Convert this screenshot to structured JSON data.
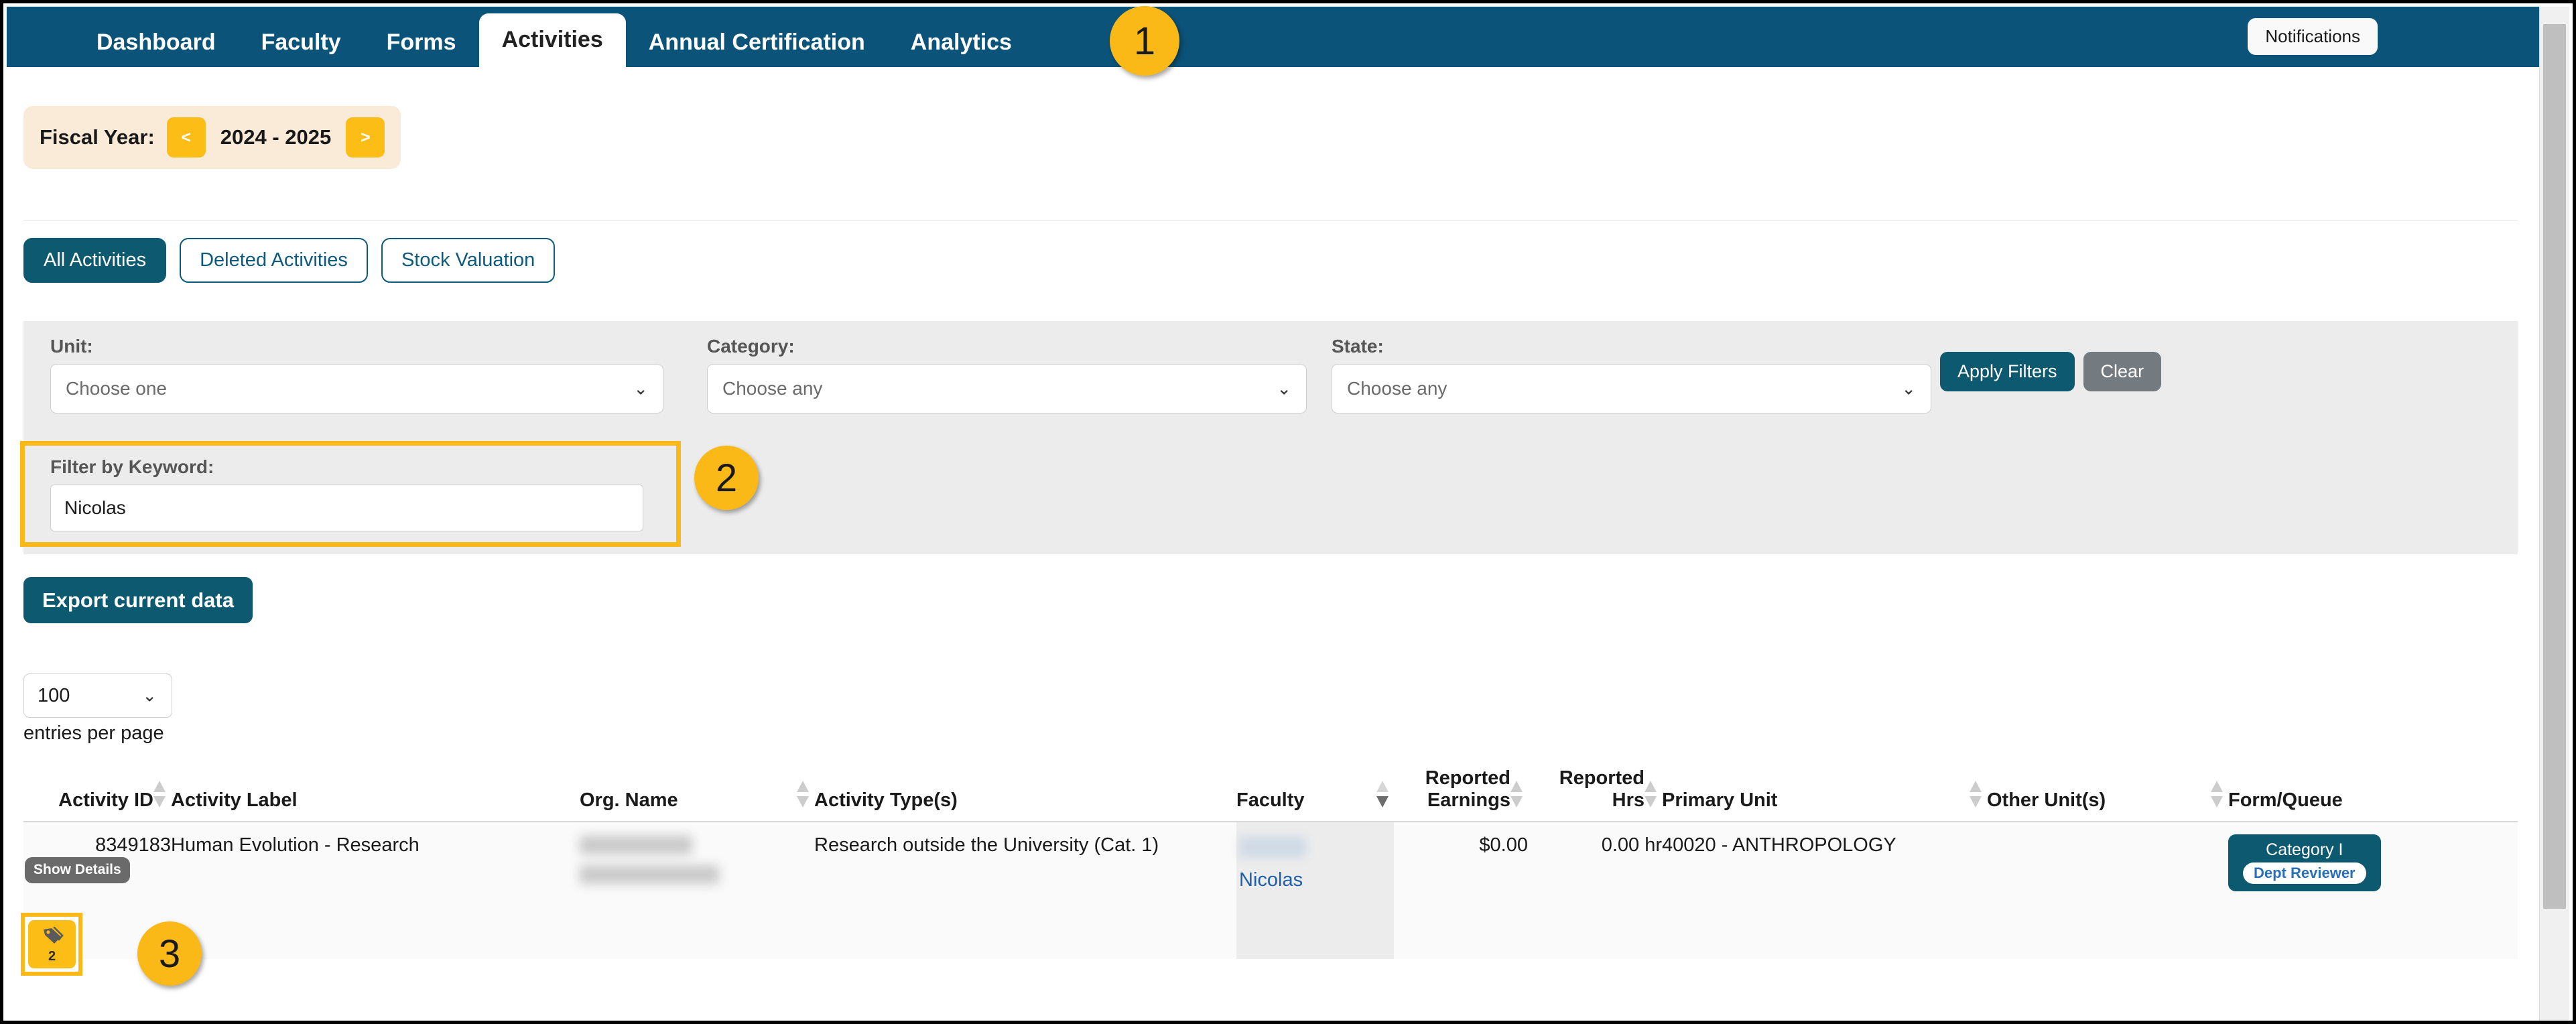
{
  "navbar": {
    "items": [
      {
        "label": "Dashboard",
        "active": false
      },
      {
        "label": "Faculty",
        "active": false
      },
      {
        "label": "Forms",
        "active": false
      },
      {
        "label": "Activities",
        "active": true
      },
      {
        "label": "Annual Certification",
        "active": false
      },
      {
        "label": "Analytics",
        "active": false
      }
    ],
    "notifications_label": "Notifications"
  },
  "markers": {
    "one": "1",
    "two": "2",
    "three": "3"
  },
  "fiscal": {
    "label": "Fiscal Year:",
    "prev": "<",
    "next": ">",
    "value": "2024 - 2025"
  },
  "pills": [
    {
      "label": "All Activities",
      "active": true
    },
    {
      "label": "Deleted Activities",
      "active": false
    },
    {
      "label": "Stock Valuation",
      "active": false
    }
  ],
  "filters": {
    "unit": {
      "label": "Unit:",
      "value": "Choose one"
    },
    "category": {
      "label": "Category:",
      "value": "Choose any"
    },
    "state": {
      "label": "State:",
      "value": "Choose any"
    },
    "keyword": {
      "label": "Filter by Keyword:",
      "value": "Nicolas",
      "placeholder": ""
    },
    "apply_label": "Apply Filters",
    "clear_label": "Clear"
  },
  "export": {
    "label": "Export current data"
  },
  "paging": {
    "entries_value": "100",
    "entries_caption": "entries per page"
  },
  "table": {
    "columns": [
      {
        "label": "Activity ID",
        "sortable": true,
        "sorted": false,
        "align": "right"
      },
      {
        "label": "Activity Label",
        "sortable": false,
        "sorted": false,
        "align": "left"
      },
      {
        "label": "Org. Name",
        "sortable": true,
        "sorted": false,
        "align": "left"
      },
      {
        "label": "Activity Type(s)",
        "sortable": false,
        "sorted": false,
        "align": "left"
      },
      {
        "label": "Faculty",
        "sortable": true,
        "sorted": true,
        "align": "left"
      },
      {
        "label": "Reported Earnings",
        "sortable": true,
        "sorted": false,
        "align": "right"
      },
      {
        "label": "Reported Hrs",
        "sortable": true,
        "sorted": false,
        "align": "right"
      },
      {
        "label": "Primary Unit",
        "sortable": true,
        "sorted": false,
        "align": "left"
      },
      {
        "label": "Other Unit(s)",
        "sortable": true,
        "sorted": false,
        "align": "left"
      },
      {
        "label": "Form/Queue",
        "sortable": false,
        "sorted": false,
        "align": "left"
      }
    ],
    "show_details_label": "Show Details",
    "tag_count": "2",
    "rows": [
      {
        "activity_id": "8349183",
        "activity_label": "Human Evolution - Research",
        "org_name": "",
        "activity_types": "Research outside the University (Cat. 1)",
        "faculty": "Nicolas",
        "reported_earnings": "$0.00",
        "reported_hrs": "0.00 hr",
        "primary_unit": "40020 - ANTHROPOLOGY",
        "other_units": "",
        "form_category": "Category I",
        "form_queue": "Dept Reviewer"
      }
    ]
  },
  "icons": {
    "tag": "tag-icon",
    "chevron_down": "⌄"
  }
}
